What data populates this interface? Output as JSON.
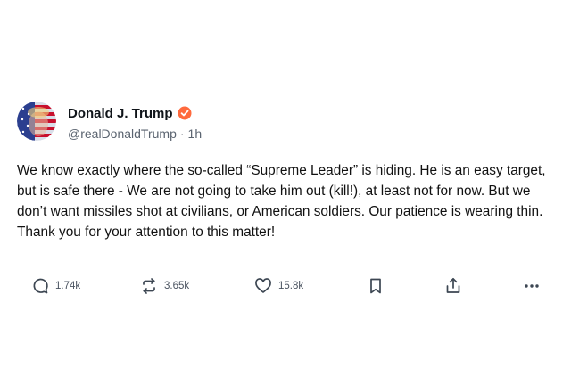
{
  "post": {
    "author": {
      "display_name": "Donald J. Trump",
      "handle": "@realDonaldTrump",
      "separator": "·",
      "time": "1h",
      "verified_icon": "verified-badge-icon",
      "verified_color": "#ff6a3d"
    },
    "text": "We know exactly where the so-called “Supreme Leader” is hiding. He is an easy target, but is safe there - We are not going to take him out (kill!), at least not for now. But we don’t want missiles shot at civilians, or American soldiers. Our patience is wearing thin. Thank you for your attention to this matter!",
    "actions": {
      "replies": {
        "icon": "reply-icon",
        "count": "1.74k"
      },
      "reposts": {
        "icon": "repost-icon",
        "count": "3.65k"
      },
      "likes": {
        "icon": "heart-icon",
        "count": "15.8k"
      },
      "bookmark": {
        "icon": "bookmark-icon"
      },
      "share": {
        "icon": "share-icon"
      },
      "more": {
        "icon": "more-icon"
      }
    }
  }
}
